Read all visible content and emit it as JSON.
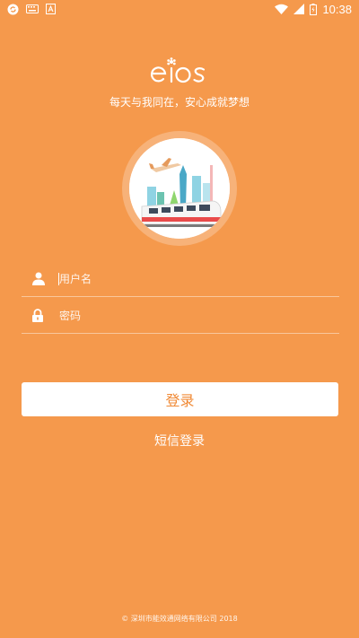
{
  "status_bar": {
    "time": "10:38",
    "icons": [
      "sync-icon",
      "keyboard-icon",
      "a-icon",
      "wifi-icon",
      "signal-icon",
      "battery-icon"
    ]
  },
  "brand": {
    "logo_text": "eios",
    "slogan": "每天与我同在，安心成就梦想"
  },
  "form": {
    "username_placeholder": "用户名",
    "password_placeholder": "密码"
  },
  "actions": {
    "login_label": "登录",
    "sms_login_label": "短信登录"
  },
  "footer": {
    "copyright": "© 深圳市能效通网络有限公司 2018"
  },
  "colors": {
    "background": "#F5994C",
    "button_text": "#F08A36"
  }
}
